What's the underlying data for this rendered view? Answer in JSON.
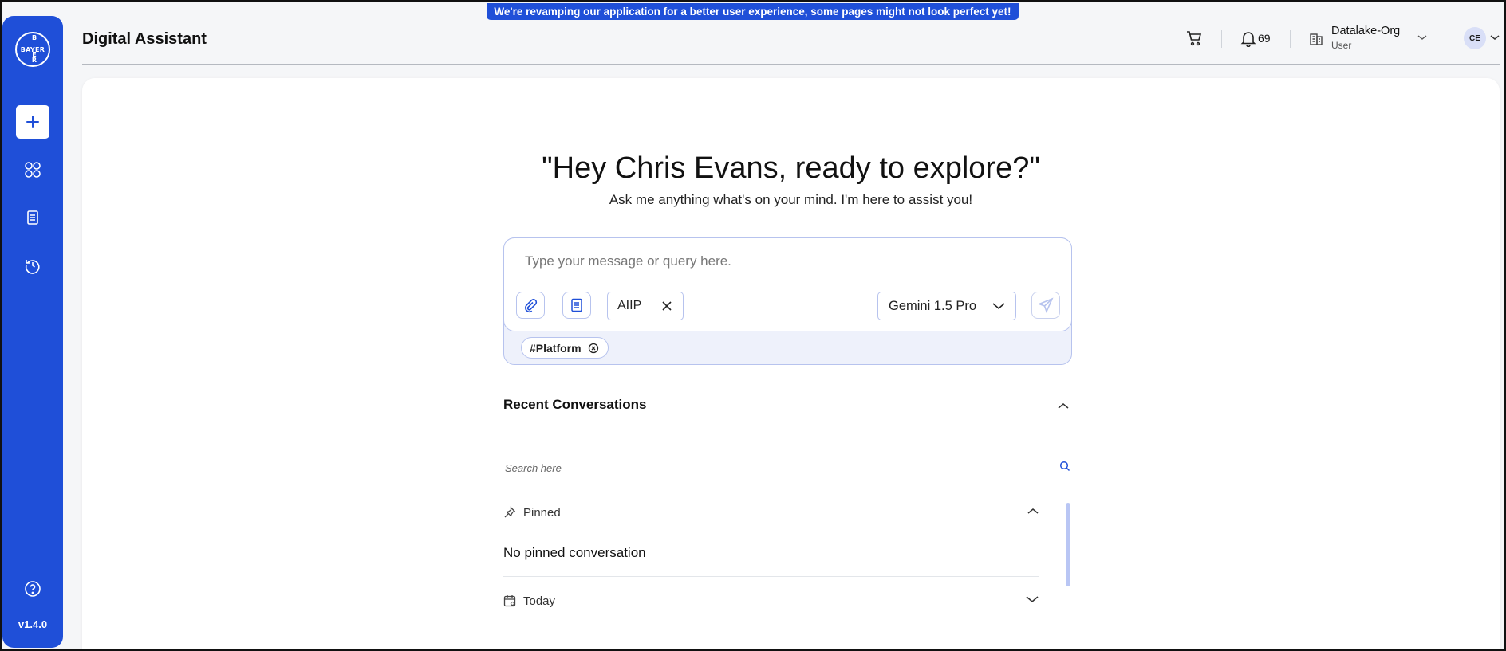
{
  "banner": {
    "text": "We're revamping our application for a better user experience, some pages might not look perfect yet!"
  },
  "sidebar": {
    "logo_horizontal": "BAYER",
    "logo_vertical": [
      "B",
      "A",
      "Y",
      "E",
      "R"
    ],
    "items": [
      {
        "name": "new-chat",
        "icon": "plus-icon"
      },
      {
        "name": "apps",
        "icon": "grid-icon"
      },
      {
        "name": "documents",
        "icon": "document-icon"
      },
      {
        "name": "history",
        "icon": "history-icon"
      }
    ],
    "help_icon": "help-icon",
    "version": "v1.4.0"
  },
  "header": {
    "title": "Digital Assistant",
    "cart_icon": "cart-icon",
    "notifications": {
      "icon": "bell-icon",
      "count": "69"
    },
    "org": {
      "icon": "building-icon",
      "name": "Datalake-Org",
      "role": "User"
    },
    "avatar_initials": "CE"
  },
  "main": {
    "greeting": "\"Hey Chris Evans, ready to explore?\"",
    "subgreeting": "Ask me anything what's on your mind. I'm here to assist you!",
    "composer": {
      "placeholder": "Type your message or query here.",
      "value": "",
      "attach_icon": "paperclip-icon",
      "prompt_icon": "document-icon",
      "chip_label": "AIIP",
      "model": "Gemini 1.5 Pro",
      "send_icon": "send-icon",
      "tag": "#Platform"
    },
    "recent": {
      "title": "Recent Conversations",
      "search_placeholder": "Search here",
      "sections": [
        {
          "label": "Pinned",
          "icon": "pin-icon",
          "expanded": true,
          "empty_text": "No pinned conversation"
        },
        {
          "label": "Today",
          "icon": "calendar-icon",
          "expanded": false
        }
      ]
    }
  },
  "colors": {
    "brand": "#1f4fd8",
    "accent_border": "#b7c3ee",
    "scrollbar": "#b9c6f4"
  }
}
